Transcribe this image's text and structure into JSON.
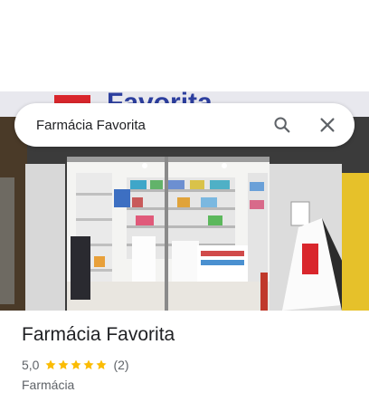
{
  "search": {
    "value": "Farmácia Favorita",
    "search_icon": "search-icon",
    "close_icon": "close-icon"
  },
  "hero": {
    "image": "storefront-photo",
    "sign_text": "Favorita"
  },
  "place": {
    "title": "Farmácia Favorita",
    "rating": "5,0",
    "stars": 5,
    "reviews": "(2)",
    "category": "Farmácia"
  },
  "colors": {
    "star": "#fbbc04",
    "title": "#202124",
    "secondary": "#5f6368"
  }
}
